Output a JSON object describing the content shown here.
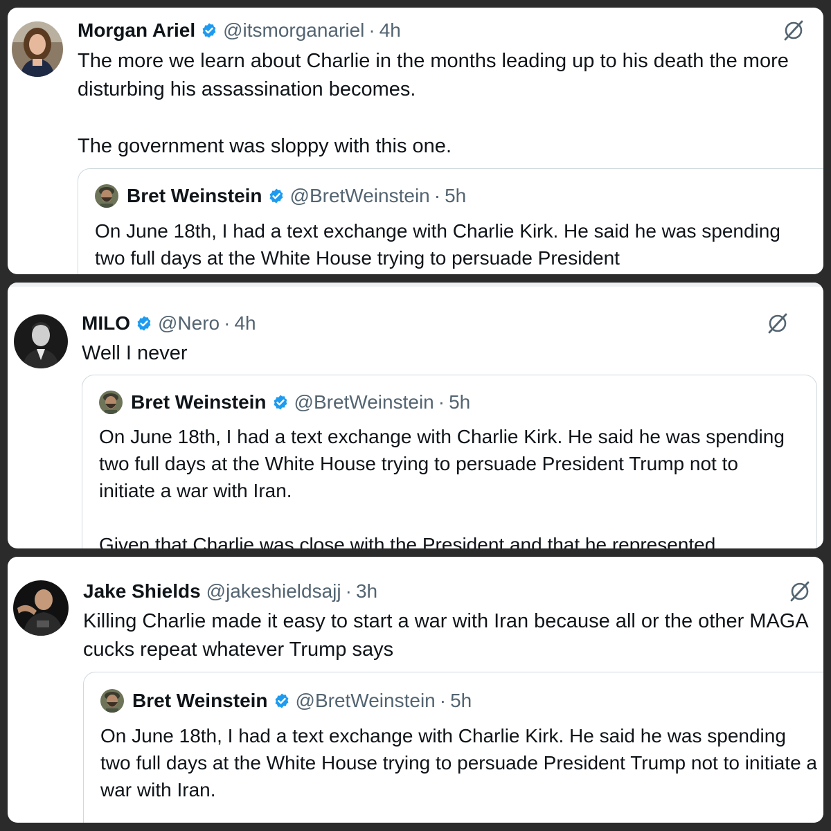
{
  "colors": {
    "background": "#2b2b2b",
    "panel": "#ffffff",
    "verified_badge": "#1d9bf0",
    "secondary_text": "#536471",
    "primary_text": "#0f1419",
    "quote_border": "#cfd9de"
  },
  "posts": [
    {
      "author": "Morgan Ariel",
      "verified": true,
      "handle": "@itsmorganariel",
      "dot": "·",
      "time": "4h",
      "avatar_icon": "woman-avatar",
      "action_icon": "grok-icon",
      "text": "The more we learn about Charlie in the months leading up to his death the more disturbing his assassination becomes.\n\nThe government was sloppy with this one.",
      "quote": {
        "author": "Bret Weinstein",
        "verified": true,
        "handle": "@BretWeinstein",
        "dot": "·",
        "time": "5h",
        "avatar_icon": "bearded-man-avatar",
        "text": "On June 18th, I had a text exchange with Charlie Kirk. He said he was spending two full days at the White House trying to persuade President"
      }
    },
    {
      "author": "MILO",
      "verified": true,
      "handle": "@Nero",
      "dot": "·",
      "time": "4h",
      "avatar_icon": "man-in-suit-avatar",
      "action_icon": "grok-icon",
      "text": "Well I never",
      "quote": {
        "author": "Bret Weinstein",
        "verified": true,
        "handle": "@BretWeinstein",
        "dot": "·",
        "time": "5h",
        "avatar_icon": "bearded-man-avatar",
        "text": "On June 18th, I had a text exchange with Charlie Kirk. He said he was spending two full days at the White House trying to persuade President Trump not to initiate a war with Iran.\n\nGiven that Charlie was close with the President and that he represented"
      }
    },
    {
      "author": "Jake Shields",
      "verified": false,
      "handle": "@jakeshieldsajj",
      "dot": "·",
      "time": "3h",
      "avatar_icon": "bald-man-avatar",
      "action_icon": "grok-icon",
      "text": "Killing Charlie made it easy to start a war with Iran because all or the other MAGA cucks repeat whatever Trump says",
      "quote": {
        "author": "Bret Weinstein",
        "verified": true,
        "handle": "@BretWeinstein",
        "dot": "·",
        "time": "5h",
        "avatar_icon": "bearded-man-avatar",
        "text": "On June 18th, I had a text exchange with Charlie Kirk. He said he was spending two full days at the White House trying to persuade President Trump not to initiate a war with Iran."
      }
    }
  ]
}
